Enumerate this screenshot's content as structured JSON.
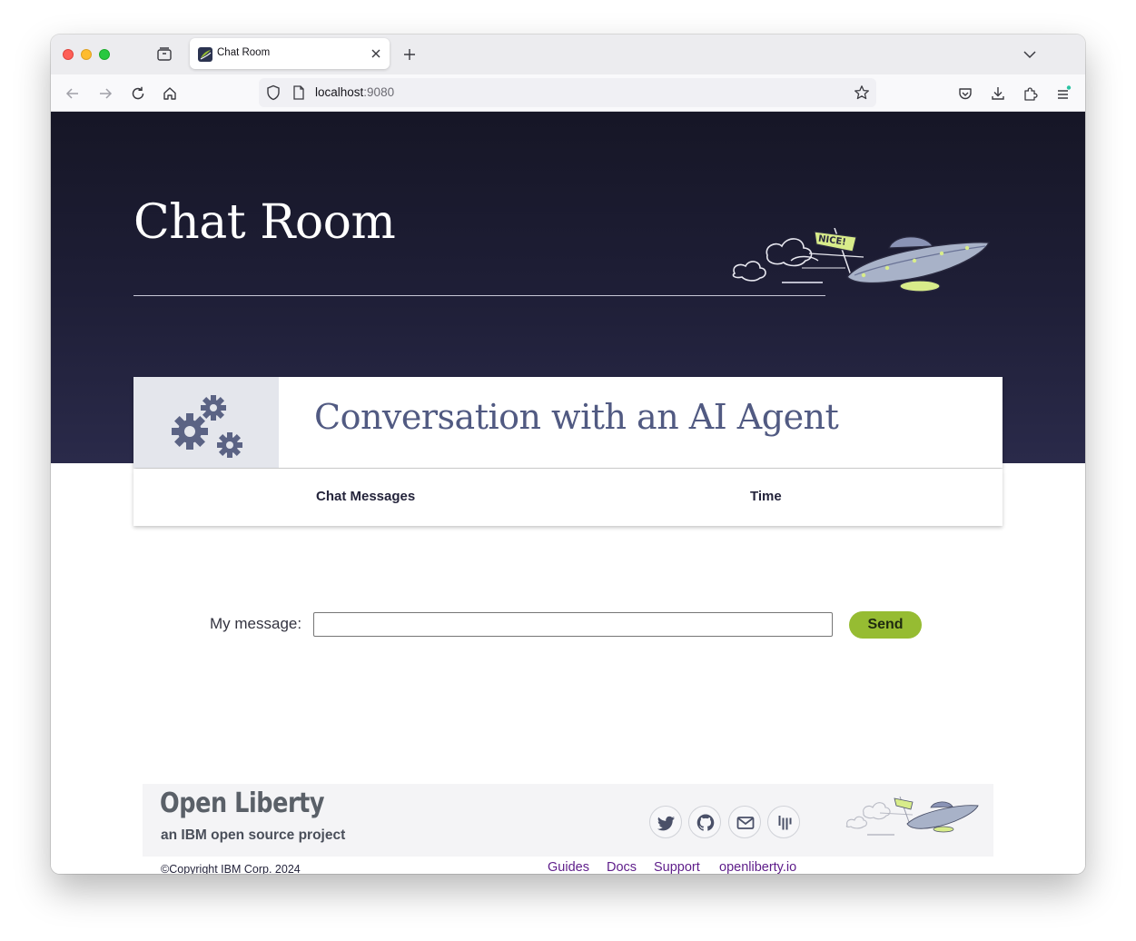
{
  "browser": {
    "tab_title": "Chat Room",
    "url_host": "localhost",
    "url_port": ":9080"
  },
  "hero": {
    "title": "Chat Room"
  },
  "card": {
    "title": "Conversation with an AI Agent",
    "icon": "gears-icon"
  },
  "ufo_sign": "NICE!",
  "table": {
    "columns": [
      "Chat Messages",
      "Time"
    ]
  },
  "form": {
    "label": "My message:",
    "input_value": "",
    "send_label": "Send"
  },
  "footer": {
    "logo_text": "Open Liberty",
    "tagline": "an IBM open source project",
    "copyright": "©Copyright IBM Corp. 2024",
    "social": [
      "twitter-icon",
      "github-icon",
      "mail-icon",
      "gitter-icon"
    ],
    "links": [
      "Guides",
      "Docs",
      "Support",
      "openliberty.io"
    ]
  },
  "colors": {
    "hero_bg": "#1e1e36",
    "card_title": "#515a82",
    "send_button": "#96bc32",
    "footer_link": "#5e1d8a"
  }
}
